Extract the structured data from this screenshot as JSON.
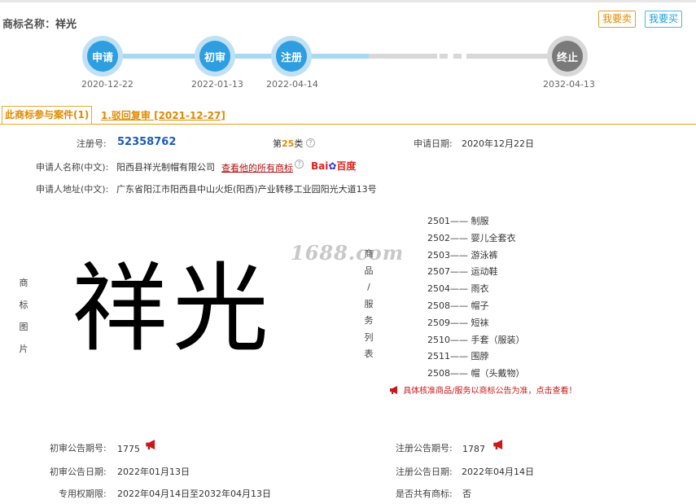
{
  "header": {
    "title_label": "商标名称：",
    "title_value": "祥光",
    "sell_button": "我要卖",
    "buy_button": "我要买"
  },
  "progress": [
    {
      "label": "申请",
      "date": "2020-12-22"
    },
    {
      "label": "初审",
      "date": "2022-01-13"
    },
    {
      "label": "注册",
      "date": "2022-04-14"
    },
    {
      "label": "终止",
      "date": "2032-04-13"
    }
  ],
  "cases": {
    "tab_label": "此商标参与案件(1)",
    "case_link": "1.驳回复审 [2021-12-27]"
  },
  "info": {
    "reg_no_label": "注册号:",
    "reg_no": "52358762",
    "class_prefix": "第",
    "class_num": "25",
    "class_suffix": "类",
    "apply_date_label": "申请日期:",
    "apply_date": "2020年12月22日",
    "applicant_label": "申请人名称(中文):",
    "applicant": "阳西县祥光制帽有限公司",
    "applicant_link": "查看他的所有商标",
    "baidu_a": "Bai",
    "baidu_b": "百度",
    "address_label": "申请人地址(中文):",
    "address": "广东省阳江市阳西县中山火炬(阳西)产业转移工业园阳光大道13号"
  },
  "image_section": {
    "label_chars": [
      "商",
      "标",
      "图",
      "片"
    ],
    "mark_text": "祥光",
    "watermark": "1688.com"
  },
  "goods_section": {
    "label_chars": [
      "商",
      "品",
      "/",
      "服",
      "务",
      "列",
      "表"
    ],
    "items": [
      "2501—— 制服",
      "2502—— 婴儿全套衣",
      "2503—— 游泳裤",
      "2507—— 运动鞋",
      "2504—— 雨衣",
      "2508—— 帽子",
      "2509—— 短袜",
      "2510—— 手套（服装）",
      "2511—— 围脖",
      "2508—— 帽（头戴物）"
    ],
    "notice": "具体核准商品/服务以商标公告为准，点击查看！"
  },
  "footer": {
    "prelim_no_label": "初审公告期号:",
    "prelim_no": "1775",
    "reg_pub_no_label": "注册公告期号:",
    "reg_pub_no": "1787",
    "prelim_date_label": "初审公告日期:",
    "prelim_date": "2022年01月13日",
    "reg_pub_date_label": "注册公告日期:",
    "reg_pub_date": "2022年04月14日",
    "exclusive_label": "专用权期限:",
    "exclusive": "2022年04月14日至2032年04月13日",
    "shared_label": "是否共有商标:",
    "shared": "否"
  },
  "colors": {
    "accent_orange": "#e08a00",
    "progress_blue": "#2e9ee0",
    "progress_gray": "#7a7a7a",
    "reg_no_blue": "#1a5bb8",
    "notice_red": "#c81818"
  }
}
